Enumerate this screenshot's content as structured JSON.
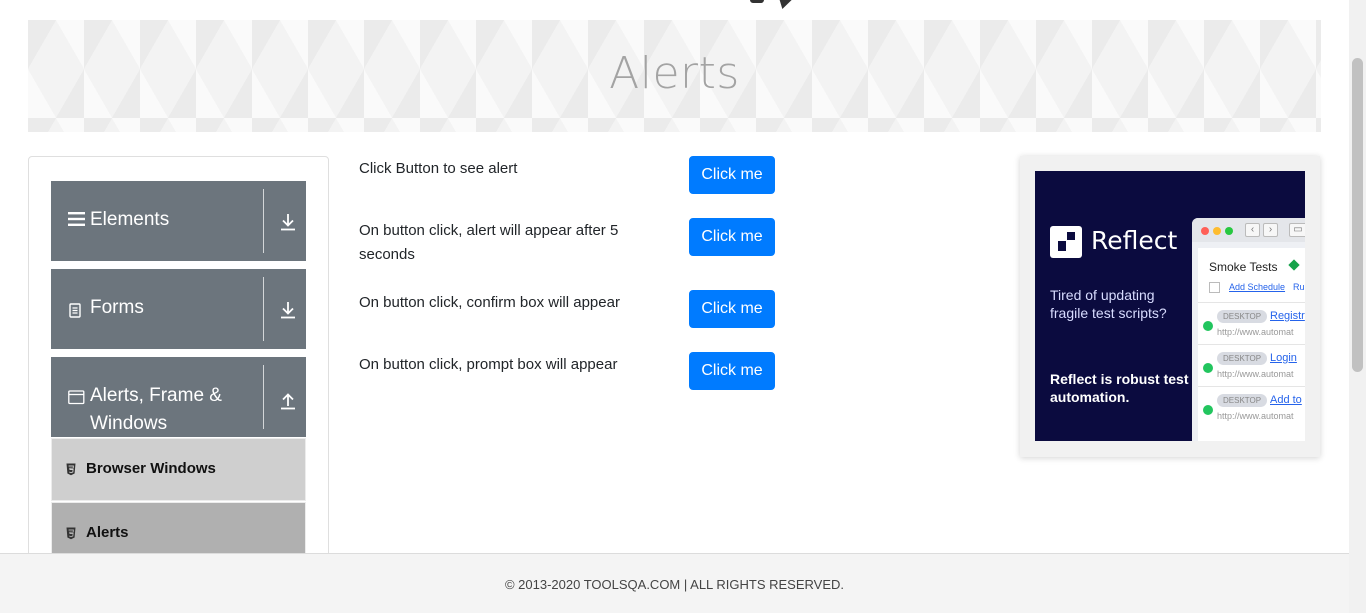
{
  "banner": {
    "title": "Alerts"
  },
  "sidebar": {
    "groups": [
      {
        "label": "Elements",
        "icon": "hamburger-icon",
        "arrow": "download-arrow-icon"
      },
      {
        "label": "Forms",
        "icon": "document-icon",
        "arrow": "download-arrow-icon"
      },
      {
        "label_line1": "Alerts, Frame &",
        "label_line2": "Windows",
        "icon": "window-icon",
        "arrow": "upload-arrow-icon"
      }
    ],
    "items": [
      {
        "label": "Browser Windows",
        "icon": "html5-icon"
      },
      {
        "label": "Alerts",
        "icon": "html5-icon"
      }
    ]
  },
  "main": {
    "rows": [
      {
        "text": "Click Button to see alert",
        "button": "Click me"
      },
      {
        "text": "On button click, alert will appear after 5 seconds",
        "button": "Click me"
      },
      {
        "text": "On button click, confirm box will appear",
        "button": "Click me"
      },
      {
        "text": "On button click, prompt box will appear",
        "button": "Click me"
      }
    ]
  },
  "ad": {
    "brand": "Reflect",
    "tagline": "Tired of updating fragile test scripts?",
    "strong": "Reflect is robust test automation.",
    "panel_title": "Smoke Tests",
    "add_schedule": "Add Schedule",
    "run_partial": "Ru",
    "tests": [
      {
        "tag": "DESKTOP",
        "name": "Registr",
        "url": "http://www.automat"
      },
      {
        "tag": "DESKTOP",
        "name": "Login",
        "url": "http://www.automat"
      },
      {
        "tag": "DESKTOP",
        "name": "Add to",
        "url": "http://www.automat"
      }
    ]
  },
  "footer": {
    "text": "© 2013-2020 TOOLSQA.COM | ALL RIGHTS RESERVED."
  },
  "colors": {
    "primary": "#007bff",
    "group_bg": "#6c757d",
    "ad_bg": "#0b0b3f"
  }
}
